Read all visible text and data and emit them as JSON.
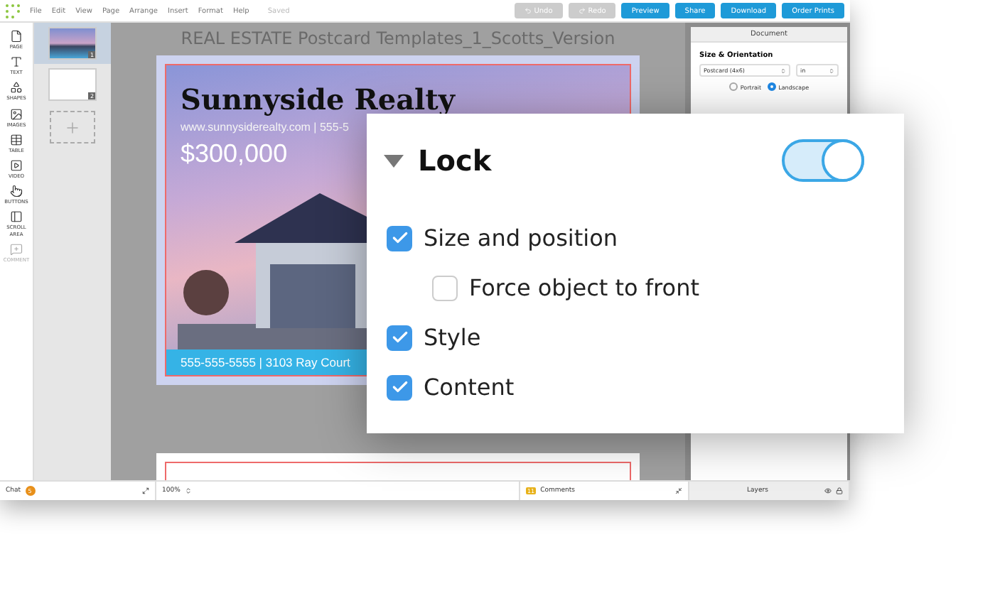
{
  "app": {
    "menu": [
      "File",
      "Edit",
      "View",
      "Page",
      "Arrange",
      "Insert",
      "Format",
      "Help"
    ],
    "save_status": "Saved",
    "toolbar_buttons": [
      {
        "label": "Undo",
        "kind": "undo",
        "disabled": true
      },
      {
        "label": "Redo",
        "kind": "redo",
        "disabled": true
      },
      {
        "label": "Preview",
        "kind": "plain",
        "disabled": false
      },
      {
        "label": "Share",
        "kind": "plain",
        "disabled": false
      },
      {
        "label": "Download",
        "kind": "plain",
        "disabled": false
      },
      {
        "label": "Order Prints",
        "kind": "plain",
        "disabled": false
      }
    ]
  },
  "tools": [
    {
      "label": "PAGE",
      "kind": "page",
      "disabled": false
    },
    {
      "label": "TEXT",
      "kind": "text",
      "disabled": false
    },
    {
      "label": "SHAPES",
      "kind": "shapes",
      "disabled": false
    },
    {
      "label": "IMAGES",
      "kind": "images",
      "disabled": false
    },
    {
      "label": "TABLE",
      "kind": "table",
      "disabled": false
    },
    {
      "label": "VIDEO",
      "kind": "video",
      "disabled": false
    },
    {
      "label": "BUTTONS",
      "kind": "buttons",
      "disabled": false
    },
    {
      "label": "SCROLL AREA",
      "kind": "scroll",
      "disabled": false
    },
    {
      "label": "COMMENT",
      "kind": "comment",
      "disabled": true
    }
  ],
  "pages": [
    {
      "number": "1",
      "selected": true,
      "kind": "photo"
    },
    {
      "number": "2",
      "selected": false,
      "kind": "back"
    }
  ],
  "document_title": "REAL ESTATE Postcard Templates_1_Scotts_Version",
  "postcard": {
    "headline": "Sunnyside Realty",
    "website": "www.sunnysiderealty.com | 555-5",
    "price": "$300,000",
    "footer": "555-555-5555 | 3103 Ray Court"
  },
  "document_panel": {
    "tab": "Document",
    "section": "Size & Orientation",
    "size_select": "Postcard (4x6)",
    "unit_select": "in",
    "orientation": [
      {
        "label": "Portrait",
        "selected": false
      },
      {
        "label": "Landscape",
        "selected": true
      }
    ]
  },
  "status_bar": {
    "chat": "Chat",
    "chat_count": "5",
    "zoom": "100%",
    "comments": "Comments",
    "comments_count": "11",
    "layers": "Layers"
  },
  "lock_panel": {
    "title": "Lock",
    "expanded": true,
    "on": true,
    "options": [
      {
        "label": "Size and position",
        "checked": true,
        "children": [
          {
            "label": "Force object to front",
            "checked": false
          }
        ]
      },
      {
        "label": "Style",
        "checked": true
      },
      {
        "label": "Content",
        "checked": true
      }
    ]
  }
}
